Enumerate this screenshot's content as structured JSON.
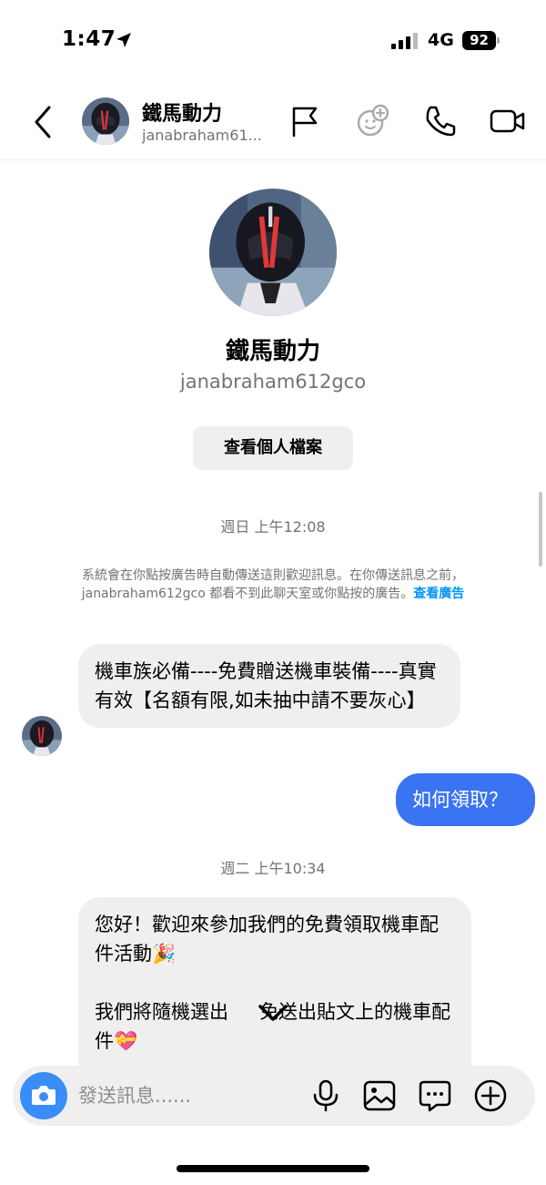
{
  "status_bar": {
    "time": "1:47",
    "network": "4G",
    "battery": "92"
  },
  "header": {
    "name": "鐵馬動力",
    "username": "janabraham61..."
  },
  "profile": {
    "name": "鐵馬動力",
    "username": "janabraham612gco",
    "view_profile_label": "查看個人檔案"
  },
  "conversation": {
    "timestamp_1": "週日 上午12:08",
    "system_notice": "系統會在你點按廣告時自動傳送這則歡迎訊息。在你傳送訊息之前，janabraham612gco 都看不到此聊天室或你點按的廣告。",
    "system_notice_link": "查看廣告",
    "msg_1": "機車族必備----免費贈送機車裝備----真實有效【名額有限,如未抽中請不要灰心】",
    "msg_out_1": "如何領取？",
    "timestamp_2": "週二 上午10:34",
    "msg_2_line_1": "您好！歡迎來參加我們的免費領取機車配件活動🎉",
    "msg_2_line_2_a": "我們將隨機選出",
    "msg_2_line_2_b": "免送出貼文上的機車配件💝"
  },
  "composer": {
    "placeholder": "發送訊息......"
  },
  "icons": {
    "back": "chevron-left-icon",
    "flag": "flag-icon",
    "sticker": "sticker-icon",
    "call": "phone-icon",
    "video": "video-camera-icon",
    "camera": "camera-icon",
    "mic": "microphone-icon",
    "gallery": "image-icon",
    "chat": "chat-bubble-icon",
    "plus": "plus-circle-icon",
    "scroll_down": "chevron-down-icon"
  },
  "colors": {
    "outgoing_bubble": "#3a74f2",
    "link": "#0095f6",
    "camera_button": "#3a8cf7"
  }
}
